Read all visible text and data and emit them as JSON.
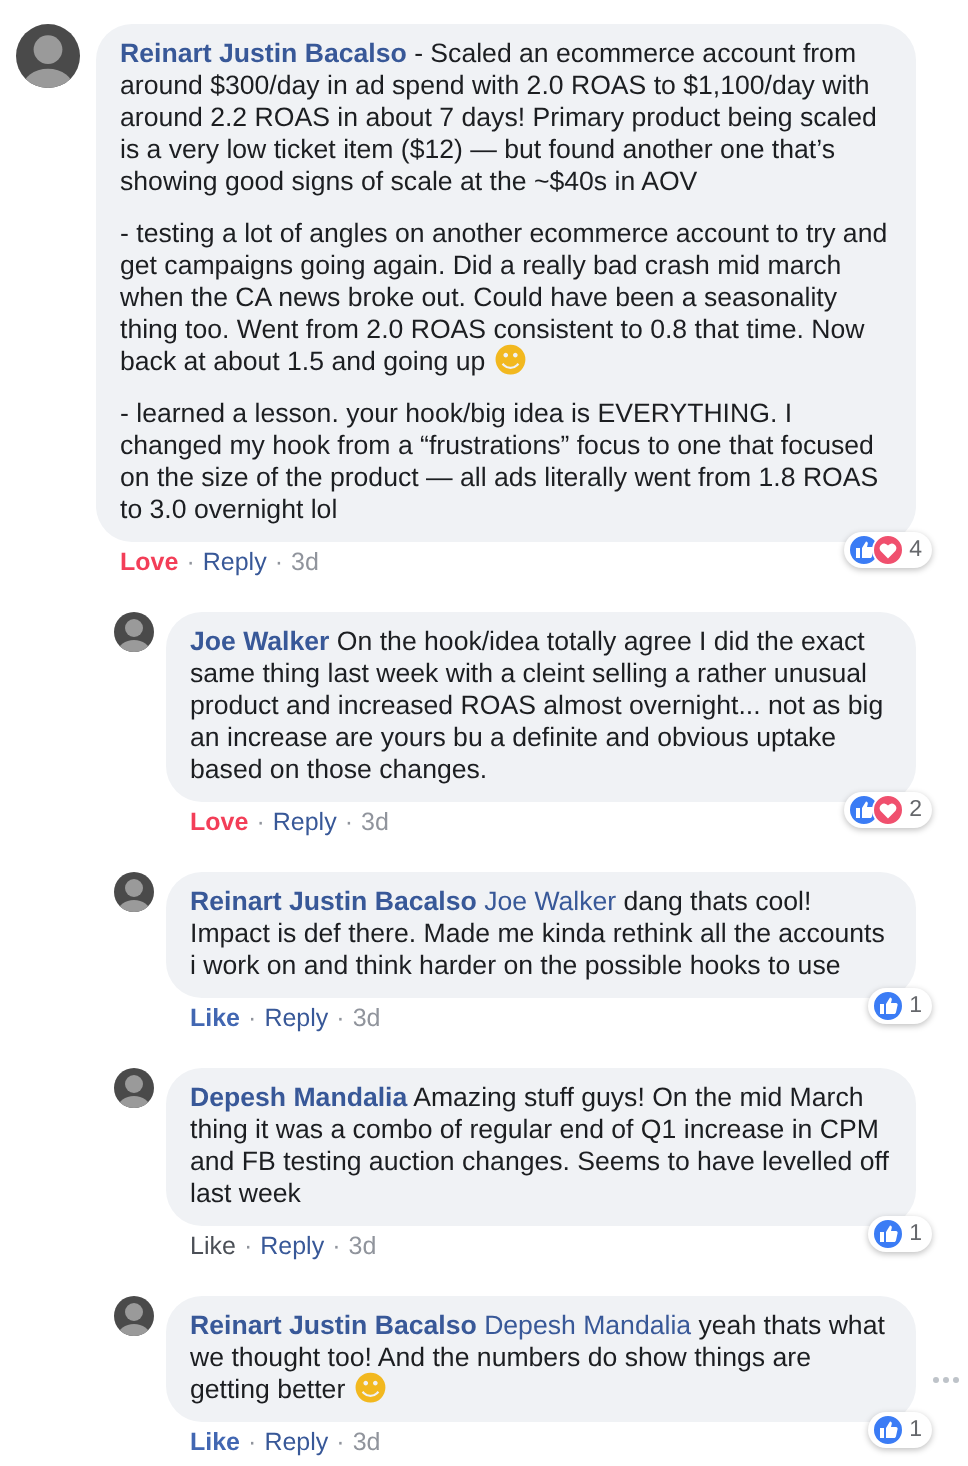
{
  "comments": [
    {
      "author": "Reinart Justin Bacalso",
      "paragraphs": [
        {
          "text": "- Scaled an ecommerce account from around $300/day in ad spend with 2.0 ROAS to $1,100/day with around 2.2 ROAS in about 7 days! Primary product being scaled is a very low ticket item ($12) — but found another one that’s showing good signs of scale at the ~$40s in AOV"
        },
        {
          "text": "- testing a lot of angles on another ecommerce account to try and get campaigns going again. Did a really bad crash mid march when the CA news broke out. Could have been a seasonality thing too. Went from 2.0 ROAS consistent to 0.8 that time. Now back at about 1.5 and going up",
          "emoji": "☻"
        },
        {
          "text": "- learned a lesson. your hook/big idea is EVERYTHING. I changed my hook from a “frustrations” focus to one that focused on the size of the product — all ads literally went from 1.8 ROAS to 3.0 overnight lol"
        }
      ],
      "reactions": [
        {
          "kind": "like"
        },
        {
          "kind": "love"
        }
      ],
      "reaction_count": "4",
      "my_reaction": {
        "kind": "love",
        "label": "Love"
      },
      "separators": [
        "·",
        "·"
      ],
      "reply": "Reply",
      "time": "3d",
      "more": false,
      "children": [
        {
          "author": "Joe Walker",
          "paragraphs": [
            {
              "text": "On the hook/idea totally agree I did the exact same thing last week with a cleint selling a rather unusual product and increased ROAS almost overnight... not as big an increase are yours bu a definite and obvious uptake based on those changes."
            }
          ],
          "reactions": [
            {
              "kind": "like"
            },
            {
              "kind": "love"
            }
          ],
          "reaction_count": "2",
          "my_reaction": {
            "kind": "love",
            "label": "Love"
          },
          "separators": [
            "·",
            "·"
          ],
          "reply": "Reply",
          "time": "3d",
          "more": false
        },
        {
          "author": "Reinart Justin Bacalso",
          "mention": "Joe Walker",
          "paragraphs": [
            {
              "text": "dang thats cool! Impact is def there. Made me kinda rethink all the accounts i work on and think harder on the possible hooks to use"
            }
          ],
          "reactions": [
            {
              "kind": "like"
            }
          ],
          "reaction_count": "1",
          "my_reaction": {
            "kind": "like",
            "label": "Like"
          },
          "separators": [
            "·",
            "·"
          ],
          "reply": "Reply",
          "time": "3d",
          "more": false
        },
        {
          "author": "Depesh Mandalia",
          "paragraphs": [
            {
              "text": "Amazing stuff guys! On the mid March thing it was a combo of regular end of Q1 increase in CPM and FB testing auction changes. Seems to have levelled off last week"
            }
          ],
          "reactions": [
            {
              "kind": "like"
            }
          ],
          "reaction_count": "1",
          "my_reaction": {
            "kind": "none",
            "label": "Like"
          },
          "separators": [
            "·",
            "·"
          ],
          "reply": "Reply",
          "time": "3d",
          "more": false
        },
        {
          "author": "Reinart Justin Bacalso",
          "mention": "Depesh Mandalia",
          "paragraphs": [
            {
              "text": "yeah thats what we thought too! And the numbers do show things are getting better",
              "emoji": "☻"
            }
          ],
          "reactions": [
            {
              "kind": "like"
            }
          ],
          "reaction_count": "1",
          "my_reaction": {
            "kind": "like",
            "label": "Like"
          },
          "separators": [
            "·",
            "·"
          ],
          "reply": "Reply",
          "time": "3d",
          "more": true
        }
      ]
    }
  ]
}
